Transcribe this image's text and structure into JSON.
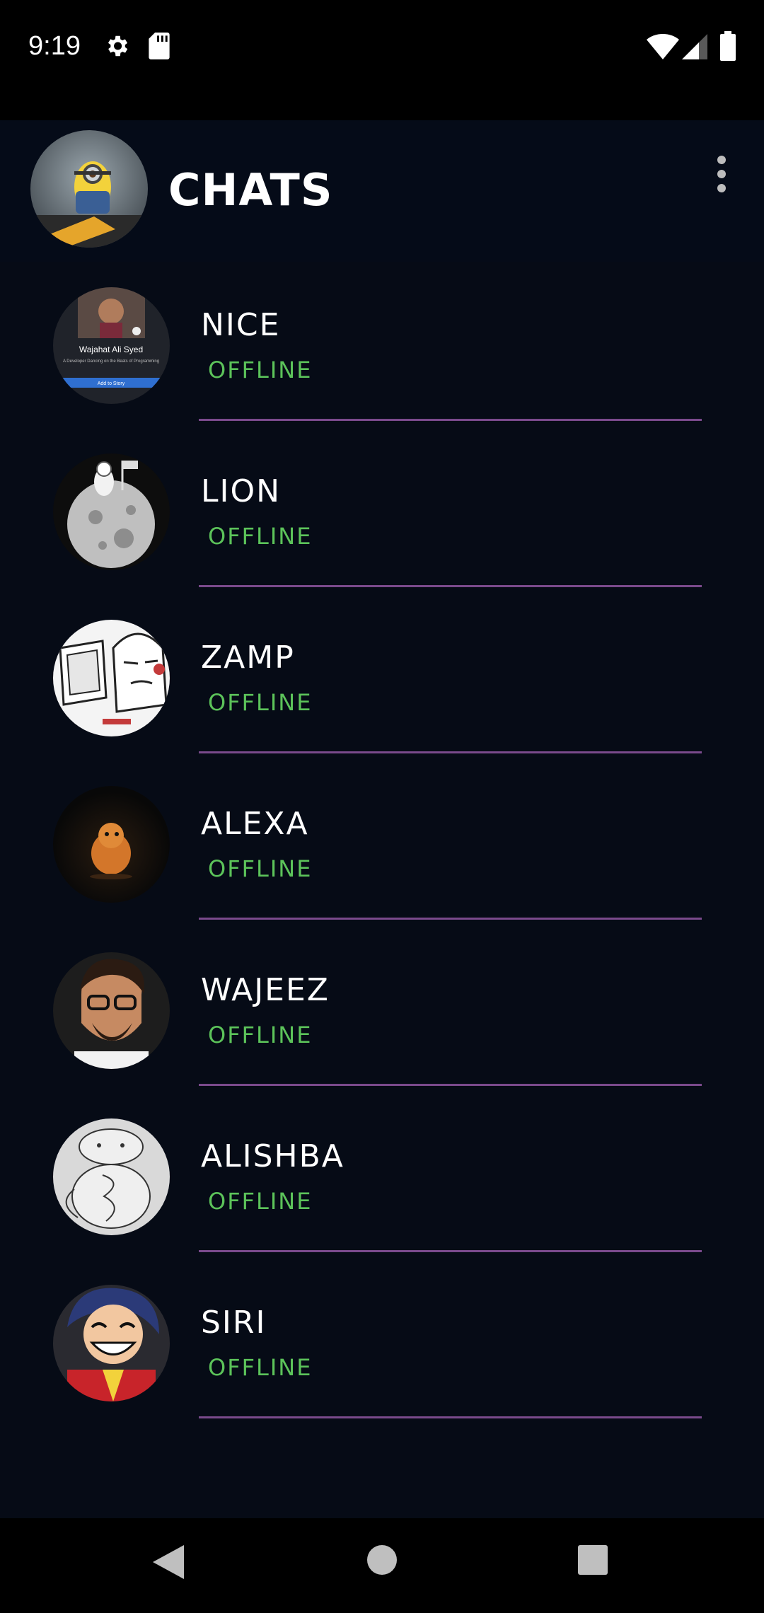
{
  "status_bar": {
    "time": "9:19",
    "icons": [
      "settings-icon",
      "sd-card-icon",
      "wifi-icon",
      "signal-icon",
      "battery-icon"
    ]
  },
  "header": {
    "title": "CHATS",
    "menu_icon": "more-vertical-icon"
  },
  "chats": [
    {
      "name": "NICE",
      "status": "OFFLINE"
    },
    {
      "name": "LION",
      "status": "OFFLINE"
    },
    {
      "name": "ZAMP",
      "status": "OFFLINE"
    },
    {
      "name": "ALEXA",
      "status": "OFFLINE"
    },
    {
      "name": "WAJEEZ",
      "status": "OFFLINE"
    },
    {
      "name": "ALISHBA",
      "status": "OFFLINE"
    },
    {
      "name": "SIRI",
      "status": "OFFLINE"
    }
  ],
  "avatar_texts": {
    "nice_name": "Wajahat Ali Syed",
    "nice_tagline": "A Developer Dancing on the Beats of Programming",
    "nice_button": "Add to Story"
  },
  "colors": {
    "background": "#060b16",
    "status_offline": "#5cc35a",
    "divider": "#7a4a8c"
  },
  "nav_bar": {
    "icons": [
      "back-icon",
      "home-icon",
      "recents-icon"
    ]
  }
}
